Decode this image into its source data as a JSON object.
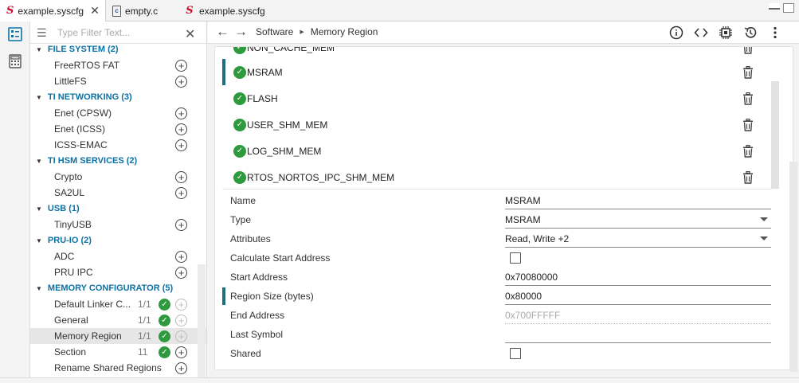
{
  "tabs": [
    {
      "label": "example.syscfg",
      "icon": "syscfg-icon",
      "active": true
    },
    {
      "label": "empty.c",
      "icon": "c-file-icon",
      "active": false
    },
    {
      "label": "example.syscfg",
      "icon": "syscfg-icon",
      "active": false
    }
  ],
  "sidebar": {
    "filter_placeholder": "Type Filter Text...",
    "tree": [
      {
        "type": "cat",
        "label": "FILE SYSTEM (2)"
      },
      {
        "type": "mod",
        "label": "FreeRTOS FAT"
      },
      {
        "type": "mod",
        "label": "LittleFS"
      },
      {
        "type": "cat",
        "label": "TI NETWORKING (3)"
      },
      {
        "type": "mod",
        "label": "Enet (CPSW)"
      },
      {
        "type": "mod",
        "label": "Enet (ICSS)"
      },
      {
        "type": "mod",
        "label": "ICSS-EMAC"
      },
      {
        "type": "cat",
        "label": "TI HSM SERVICES (2)"
      },
      {
        "type": "mod",
        "label": "Crypto"
      },
      {
        "type": "mod",
        "label": "SA2UL"
      },
      {
        "type": "cat",
        "label": "USB (1)"
      },
      {
        "type": "mod",
        "label": "TinyUSB"
      },
      {
        "type": "cat",
        "label": "PRU-IO (2)"
      },
      {
        "type": "mod",
        "label": "ADC"
      },
      {
        "type": "mod",
        "label": "PRU IPC"
      },
      {
        "type": "cat",
        "label": "MEMORY CONFIGURATOR (5)"
      },
      {
        "type": "mod",
        "label": "Default Linker C...",
        "count": "1/1"
      },
      {
        "type": "mod",
        "label": "General",
        "count": "1/1"
      },
      {
        "type": "mod",
        "label": "Memory Region",
        "count": "1/1"
      },
      {
        "type": "mod",
        "label": "Section",
        "count": "11"
      },
      {
        "type": "mod",
        "label": "Rename Shared Regions"
      }
    ]
  },
  "header": {
    "breadcrumb": [
      "Software",
      "Memory Region"
    ]
  },
  "regions": [
    {
      "name": "NON_CACHE_MEM"
    },
    {
      "name": "MSRAM"
    },
    {
      "name": "FLASH"
    },
    {
      "name": "USER_SHM_MEM"
    },
    {
      "name": "LOG_SHM_MEM"
    },
    {
      "name": "RTOS_NORTOS_IPC_SHM_MEM"
    }
  ],
  "properties": {
    "name": {
      "label": "Name",
      "value": "MSRAM"
    },
    "type": {
      "label": "Type",
      "value": "MSRAM"
    },
    "attributes": {
      "label": "Attributes",
      "value": "Read, Write +2"
    },
    "calc_start": {
      "label": "Calculate Start Address",
      "checked": false
    },
    "start_address": {
      "label": "Start Address",
      "value": "0x70080000"
    },
    "region_size": {
      "label": "Region Size (bytes)",
      "value": "0x80000"
    },
    "end_address": {
      "label": "End Address",
      "value": "0x700FFFFF"
    },
    "last_symbol": {
      "label": "Last Symbol",
      "value": ""
    },
    "shared": {
      "label": "Shared",
      "checked": false
    }
  },
  "colors": {
    "accent": "#0a72a6",
    "check_green": "#2e9a3e",
    "selection_bar": "#1f6f83"
  }
}
